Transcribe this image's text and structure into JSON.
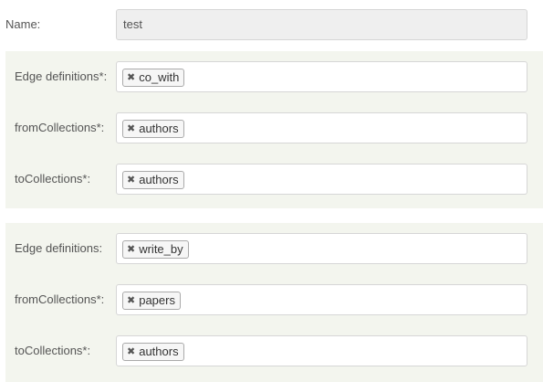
{
  "name": {
    "label": "Name:",
    "value": "test"
  },
  "edge_groups": [
    {
      "rows": [
        {
          "label": "Edge definitions*:",
          "tag": "co_with",
          "remove_icon": "close-icon"
        },
        {
          "label": "fromCollections*:",
          "tag": "authors",
          "remove_icon": "close-icon"
        },
        {
          "label": "toCollections*:",
          "tag": "authors",
          "remove_icon": "close-icon"
        }
      ]
    },
    {
      "rows": [
        {
          "label": "Edge definitions:",
          "tag": "write_by",
          "remove_icon": "close-icon"
        },
        {
          "label": "fromCollections*:",
          "tag": "papers",
          "remove_icon": "close-icon"
        },
        {
          "label": "toCollections*:",
          "tag": "authors",
          "remove_icon": "close-icon"
        }
      ]
    }
  ],
  "colors": {
    "section_bg": "#f3f5ee",
    "readonly_bg": "#efefef",
    "border": "#d6d6d6"
  },
  "glyphs": {
    "remove": "✖"
  }
}
